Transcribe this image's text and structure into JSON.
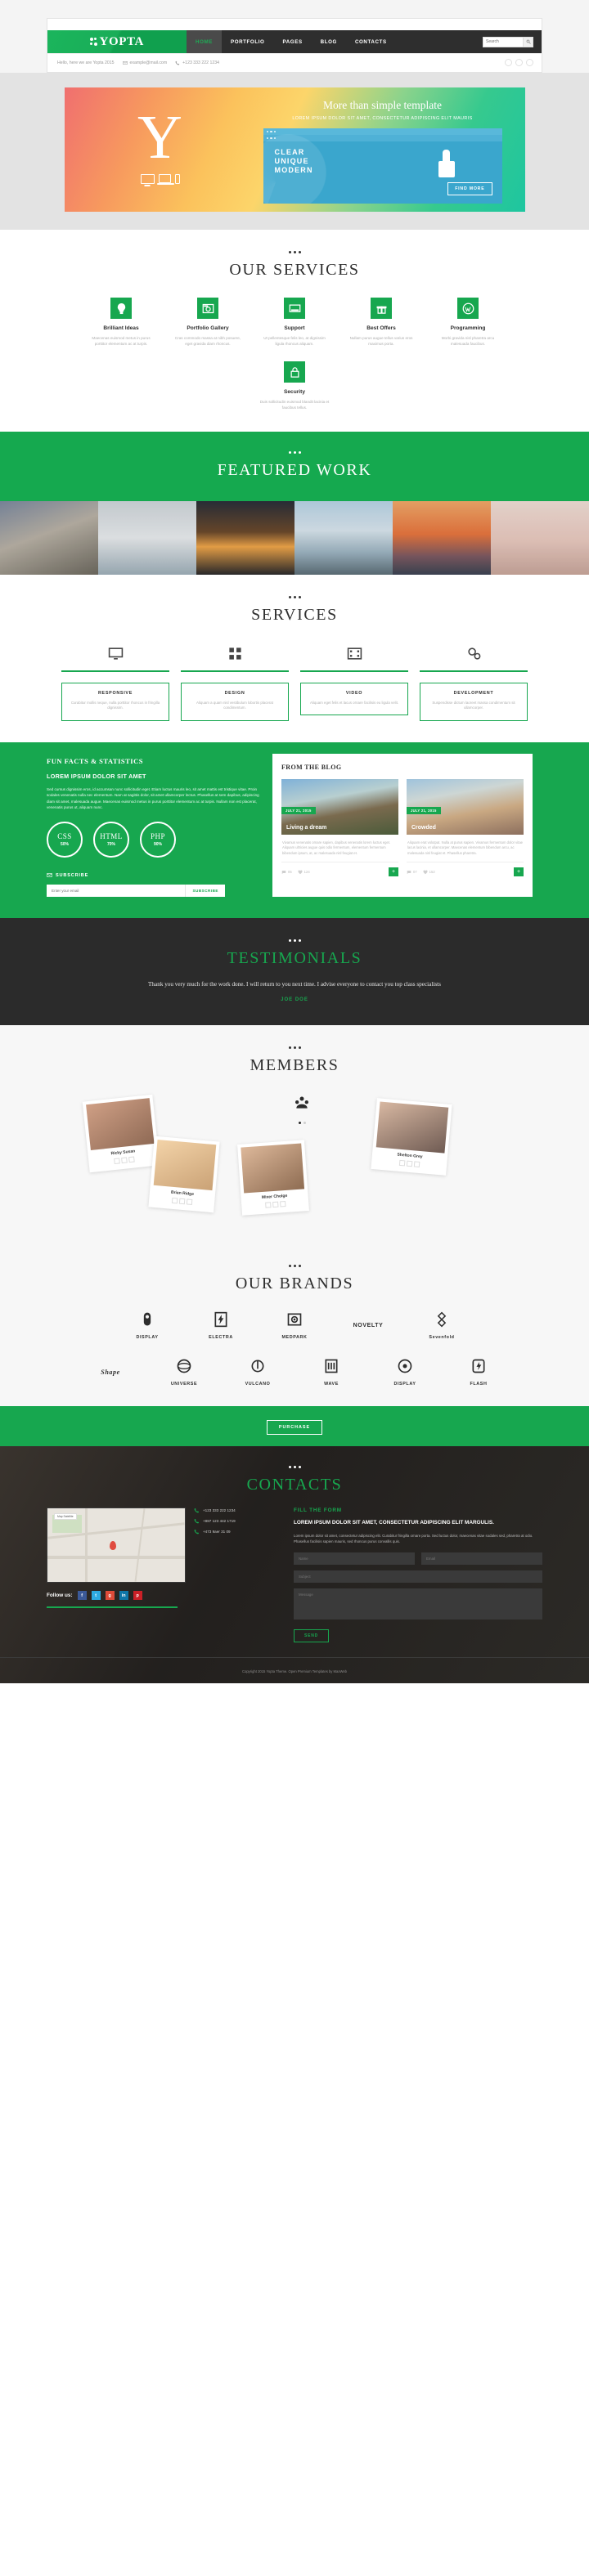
{
  "header": {
    "logo_text": "YOPTA",
    "menu": [
      {
        "label": "HOME",
        "active": true
      },
      {
        "label": "PORTFOLIO",
        "active": false
      },
      {
        "label": "PAGES",
        "active": false
      },
      {
        "label": "BLOG",
        "active": false
      },
      {
        "label": "CONTACTS",
        "active": false
      }
    ],
    "search_placeholder": "Search",
    "search_value": "",
    "tagline": "Hello, here we are Yopta 2015",
    "email": "example@mail.com",
    "phone": "+123 333 222 1234"
  },
  "hero": {
    "logo_letter": "Y",
    "title": "More than simple template",
    "subtitle": "LOREM IPSUM DOLOR SIT AMET, CONSECTETUR ADIPISCING ELIT MAURIS",
    "card_text": "CLEAR\nUNIQUE\nMODERN",
    "button": "FIND MORE"
  },
  "our_services": {
    "title": "OUR SERVICES",
    "items": [
      {
        "name": "Brilliant Ideas",
        "icon": "lightbulb-icon",
        "desc": "Maecenas euismod metus in purus porttitor elementum ac at turpis."
      },
      {
        "name": "Portfolio Gallery",
        "icon": "camera-icon",
        "desc": "Cras commodo massa at nibh posuere, eget gravida diam rhoncus."
      },
      {
        "name": "Support",
        "icon": "support-icon",
        "desc": "Ut pellentesque felis leo, at dignissim ligula rhoncus aliquam."
      },
      {
        "name": "Best Offers",
        "icon": "gift-icon",
        "desc": "Nullam purus augue tellus varius eros maximus porta."
      },
      {
        "name": "Programming",
        "icon": "wordpress-icon",
        "desc": "Morbi gravida nisl pharetra arcu malesuada faucibus."
      },
      {
        "name": "Security",
        "icon": "lock-icon",
        "desc": "Duis sollicitudin euismod blandit lacinia et faucibus tellus."
      }
    ]
  },
  "featured_work": {
    "title": "FEATURED WORK",
    "images": [
      "city-buildings",
      "airplane-wing",
      "sunset-road",
      "lifeguard-tower",
      "golden-gate-bridge",
      "flowers"
    ]
  },
  "services_boxes": {
    "title": "SERVICES",
    "items": [
      {
        "name": "RESPONSIVE",
        "icon": "monitor-icon",
        "desc": "Curabitur mollis neque, nulla porttitor rhoncus in fringilla dignissim."
      },
      {
        "name": "DESIGN",
        "icon": "layers-icon",
        "desc": "Aliquam a quam nisl vestibulum lobortis placerat condimentum."
      },
      {
        "name": "VIDEO",
        "icon": "film-icon",
        "desc": "Aliquam eget felis et lacus ornare facilisis eu ligula velit."
      },
      {
        "name": "DEVELOPMENT",
        "icon": "cogs-icon",
        "desc": "Suspendisse dictum laoreet massa condimentum sit ullamcorper."
      }
    ]
  },
  "fun_facts": {
    "heading": "FUN FACTS & STATISTICS",
    "subheading": "LOREM IPSUM DOLOR SIT AMET",
    "paragraph": "Sed cursus dignissim eros, id accumsan nunc sollicitudin eget. Etiam luctus mauris leo, sit amet mattis est tristique vitae. Proin sodales venenatis nulla nec elementum. Nam at sagittis dolor, sit amet ullamcorper lectus. Phasellus at sem dapibus, adipiscing diam sit amet, malesuada augue. Maecenas euismod metus in purus porttitor elementum ac at turpis. Nullam non est placerat, venenatis purus ut, aliquam nunc.",
    "skills": [
      {
        "label": "CSS",
        "value": "50%"
      },
      {
        "label": "HTML",
        "value": "70%"
      },
      {
        "label": "PHP",
        "value": "90%"
      }
    ],
    "subscribe_heading": "SUBSCRIBE",
    "subscribe_placeholder": "Enter your email",
    "subscribe_button": "SUBSCRIBE"
  },
  "blog": {
    "heading": "FROM THE BLOG",
    "posts": [
      {
        "date": "JULY 21, 2015",
        "title": "Living a dream",
        "body": "Vivamus venenatis ornare sapien, dapibus venenatis lorem luctus eget. Aliquam ultricies augue quis odio fermentum, elementum fermentum bibendum ipsum, at, ac malesuada nisl feugiat et.",
        "comments": "05",
        "likes": "124",
        "more": "+"
      },
      {
        "date": "JULY 21, 2015",
        "title": "Crowded",
        "body": "Aliquam erat volutpat. Nulla at purus sapien. Vivamus fermentum dolor vitae lacus lacinia, et ullamcorper. Maecenas elementum bibendum arcu, ac malesuada nisl feugiat et. Phasellus pharetra.",
        "comments": "07",
        "likes": "152",
        "more": "+"
      }
    ]
  },
  "testimonials": {
    "title": "TESTIMONIALS",
    "quote": "Thank you very much for the work done. I will return to you next time. I advise everyone to contact you top class specialists",
    "author": "JOE DOE"
  },
  "members": {
    "title": "MEMBERS",
    "people": [
      {
        "name": "Ricky Susan"
      },
      {
        "name": "Brian Ridge"
      },
      {
        "name": "Mixer Cholge"
      },
      {
        "name": "Shelton Grey"
      }
    ]
  },
  "brands": {
    "title": "OUR BRANDS",
    "row1": [
      "DISPLAY",
      "ELECTRA",
      "MEDPARK",
      "NOVELTY",
      "Sevenfold"
    ],
    "row2": [
      "Shape",
      "UNIVERSE",
      "VULCANO",
      "WAVE",
      "DISPLAY",
      "FLASH"
    ]
  },
  "purchase": {
    "button": "PURCHASE"
  },
  "contacts": {
    "title": "CONTACTS",
    "map_label": "Map  Satellite",
    "phones": [
      "+123 333 222 1234",
      "+887 123 442 1719",
      "+473 9aer 31 09"
    ],
    "follow_label": "Follow us:",
    "socials": [
      "f",
      "t",
      "g",
      "in",
      "p"
    ],
    "form_heading": "FILL THE FORM",
    "form_title": "LOREM IPSUM DOLOR SIT AMET, CONSECTETUR ADIPISCING ELIT MARGULIS.",
    "form_paragraph": "Lorem ipsum dolor sit amet, consectetur adipiscing elit. Curabitur fringilla ornare porta. Sed luctus dolor, maecenas vitae sodales sed, pharetra at odio. Phasellus facilisis sapien mauris, sed rhoncus purus convallis quis.",
    "field_name": "Name",
    "field_email": "Email",
    "field_subject": "Subject",
    "field_message": "Message",
    "send_button": "SEND"
  },
  "footer": {
    "copyright": "Copyright 2015 Yopta Theme. Open Premium Templates by MaxWeb"
  },
  "colors": {
    "brand_green": "#17a74f",
    "dark": "#2b2b2b",
    "light_bg": "#f7f7f7"
  }
}
